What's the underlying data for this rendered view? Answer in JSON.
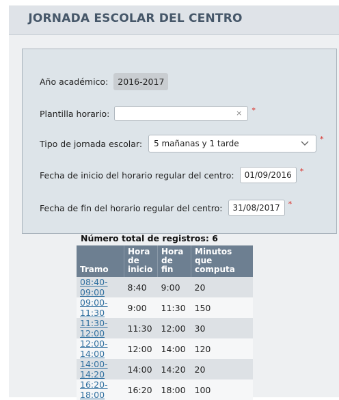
{
  "header": {
    "title": "JORNADA ESCOLAR DEL CENTRO"
  },
  "form": {
    "academic_year": {
      "label": "Año académico:",
      "value": "2016-2017"
    },
    "schedule_template": {
      "label": "Plantilla horario:",
      "value": "",
      "clear_symbol": "×",
      "required_mark": "*"
    },
    "school_day_type": {
      "label": "Tipo de jornada escolar:",
      "value": "5 mañanas y 1 tarde",
      "required_mark": "*"
    },
    "start_date": {
      "label": "Fecha de inicio del horario regular del centro:",
      "value": "01/09/2016",
      "required_mark": "*"
    },
    "end_date": {
      "label": "Fecha de fin del horario regular del centro:",
      "value": "31/08/2017",
      "required_mark": "*"
    }
  },
  "records": {
    "total_label": "Número total de registros: 6",
    "headers": {
      "tramo": "Tramo",
      "inicio_1": "Hora de",
      "inicio_2": "inicio",
      "fin_1": "Hora de",
      "fin_2": "fin",
      "min_1": "Minutos",
      "min_2": "que computa"
    },
    "rows": [
      {
        "tramo": "08:40-09:00",
        "inicio": "8:40",
        "fin": "9:00",
        "minutos": "20"
      },
      {
        "tramo": "09:00-11:30",
        "inicio": "9:00",
        "fin": "11:30",
        "minutos": "150"
      },
      {
        "tramo": "11:30-12:00",
        "inicio": "11:30",
        "fin": "12:00",
        "minutos": "30"
      },
      {
        "tramo": "12:00-14:00",
        "inicio": "12:00",
        "fin": "14:00",
        "minutos": "120"
      },
      {
        "tramo": "14:00-14:20",
        "inicio": "14:00",
        "fin": "14:20",
        "minutos": "20"
      },
      {
        "tramo": "16:20-18:00",
        "inicio": "16:20",
        "fin": "18:00",
        "minutos": "100"
      }
    ]
  },
  "colors": {
    "header_bg": "#dfe3e8",
    "title_text": "#465769",
    "table_header_bg": "#6d7f91",
    "link": "#2f6f9f",
    "required": "#d9241c"
  },
  "icons": {
    "select_arrow": "chevron-down-icon",
    "clear": "close-icon"
  }
}
